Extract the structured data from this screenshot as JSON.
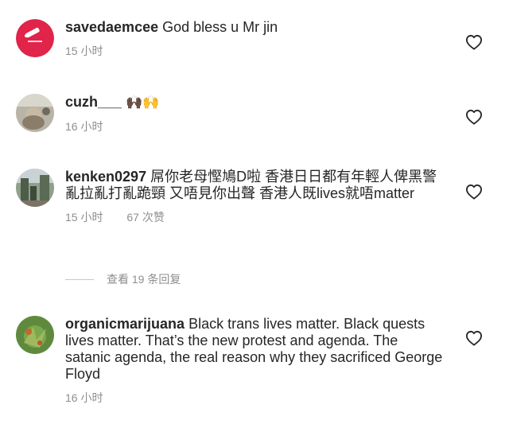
{
  "comments": [
    {
      "username": "savedaemcee",
      "text": "God bless u Mr jin",
      "time": "15 小时",
      "likes": ""
    },
    {
      "username": "cuzh___",
      "text": "🙌🏿🙌",
      "time": "16 小时",
      "likes": ""
    },
    {
      "username": "kenken0297",
      "text": "屌你老母慳鳩D啦 香港日日都有年輕人俾黑警亂拉亂打亂跪頸 又唔見你出聲 香港人既lives就唔matter",
      "time": "15 小时",
      "likes": "67 次赞"
    },
    {
      "username": "organicmarijuana",
      "text": "Black trans lives matter. Black quests lives matter. That’s the new protest and agenda. The satanic agenda, the real reason why they sacrificed George Floyd",
      "time": "16 小时",
      "likes": ""
    }
  ],
  "replies_label": "查看 19 条回复",
  "icons": {
    "like": "heart-outline-icon"
  },
  "colors": {
    "text": "#262626",
    "secondary": "#8e8e8e",
    "avatar_red": "#e0244a"
  }
}
